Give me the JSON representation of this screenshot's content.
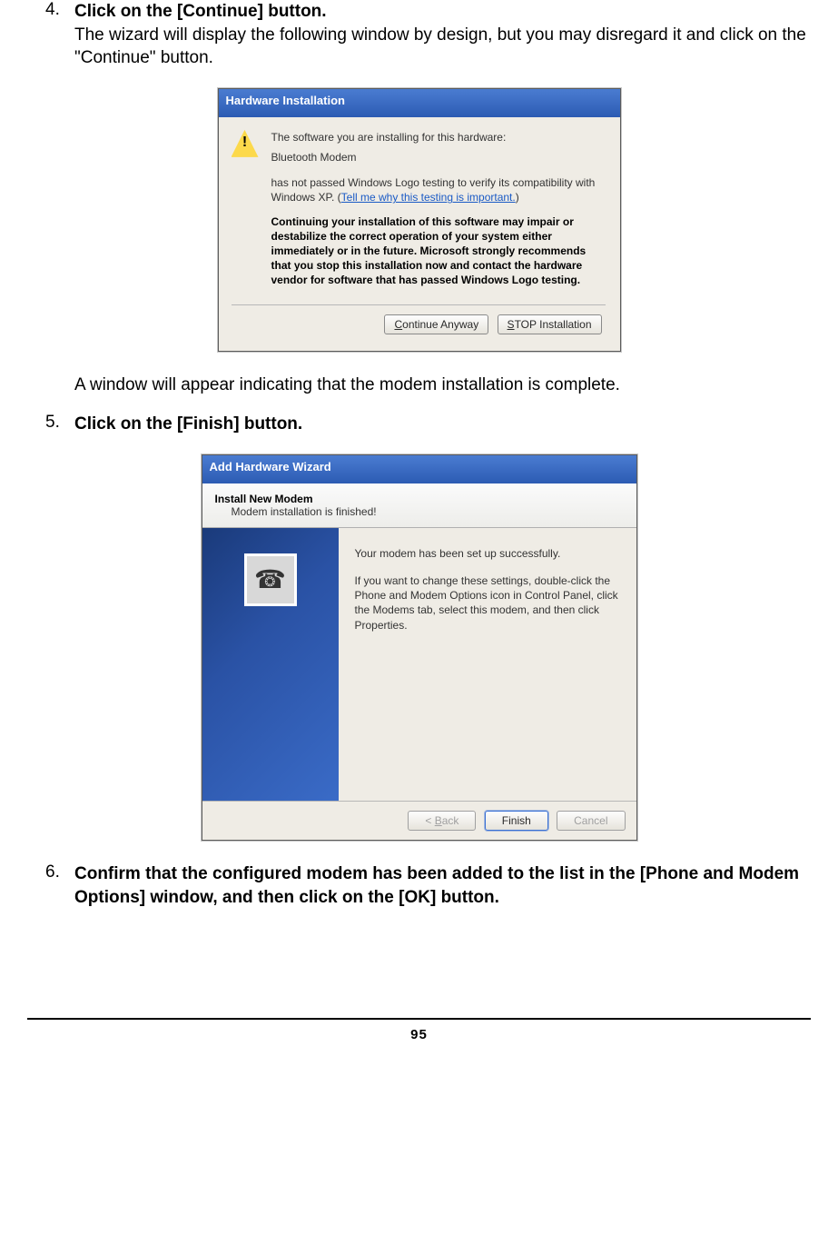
{
  "steps": {
    "s4": {
      "num": "4.",
      "title": "Click on the [Continue] button.",
      "body": "The wizard will display the following window by design, but you may disregard it and click on the \"Continue\" button."
    },
    "s4_after": "A window will appear indicating that the modem installation is complete.",
    "s5": {
      "num": "5.",
      "title": "Click on the [Finish] button."
    },
    "s6": {
      "num": "6.",
      "title": "Confirm that the configured modem has been added to the list in the [Phone and Modem Options] window, and then click on the [OK] button."
    }
  },
  "dlg1": {
    "title": "Hardware Installation",
    "line1": "The software you are installing for this hardware:",
    "line2": "Bluetooth Modem",
    "line3a": "has not passed Windows Logo testing to verify its compatibility with Windows XP. (",
    "link": "Tell me why this testing is important.",
    "line3b": ")",
    "bold": "Continuing your installation of this software may impair or destabilize the correct operation of your system either immediately or in the future. Microsoft strongly recommends that you stop this installation now and contact the hardware vendor for software that has passed Windows Logo testing.",
    "btn_continue_pre": "C",
    "btn_continue_rest": "ontinue Anyway",
    "btn_stop_pre": "S",
    "btn_stop_rest": "TOP Installation"
  },
  "dlg2": {
    "title": "Add Hardware Wizard",
    "head_title": "Install New Modem",
    "head_sub": "Modem installation is finished!",
    "body1": "Your modem has been set up successfully.",
    "body2": "If you want to change these settings, double-click the Phone and Modem Options icon in Control Panel, click the Modems tab, select this modem, and then click Properties.",
    "btn_back_pre": "< ",
    "btn_back_accel": "B",
    "btn_back_rest": "ack",
    "btn_finish": "Finish",
    "btn_cancel": "Cancel",
    "icon_glyph": "☎"
  },
  "page_number": "95"
}
